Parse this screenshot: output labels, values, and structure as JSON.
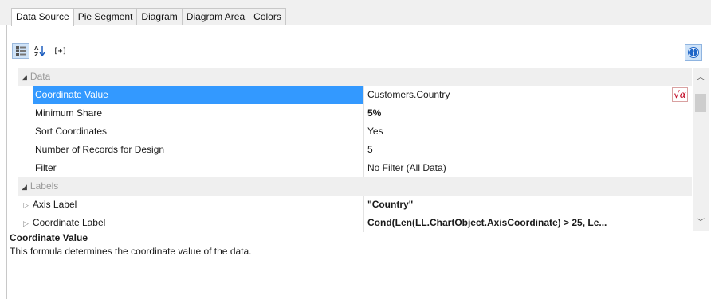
{
  "tabs": [
    "Data Source",
    "Pie Segment",
    "Diagram",
    "Diagram Area",
    "Colors"
  ],
  "toolbar": {
    "expand_label": "[+]"
  },
  "grid": {
    "categories": {
      "data": "Data",
      "labels": "Labels"
    },
    "rows": [
      {
        "name": "Coordinate Value",
        "value": "Customers.Country"
      },
      {
        "name": "Minimum Share",
        "value": "5%"
      },
      {
        "name": "Sort Coordinates",
        "value": "Yes"
      },
      {
        "name": "Number of Records for Design",
        "value": "5"
      },
      {
        "name": "Filter",
        "value": "No Filter (All Data)"
      },
      {
        "name": "Axis Label",
        "value": "\"Country\""
      },
      {
        "name": "Coordinate Label",
        "value": "Cond(Len(LL.ChartObject.AxisCoordinate) > 25, Le..."
      }
    ]
  },
  "description": {
    "title": "Coordinate Value",
    "text": "This formula determines the coordinate value of the data."
  },
  "colors": {
    "selection": "#3399ff",
    "formula_icon": "#c0001d",
    "category_bg": "#efefef"
  },
  "icons": [
    "categorized-icon",
    "sort-alpha-icon",
    "formula-icon",
    "info-icon"
  ]
}
